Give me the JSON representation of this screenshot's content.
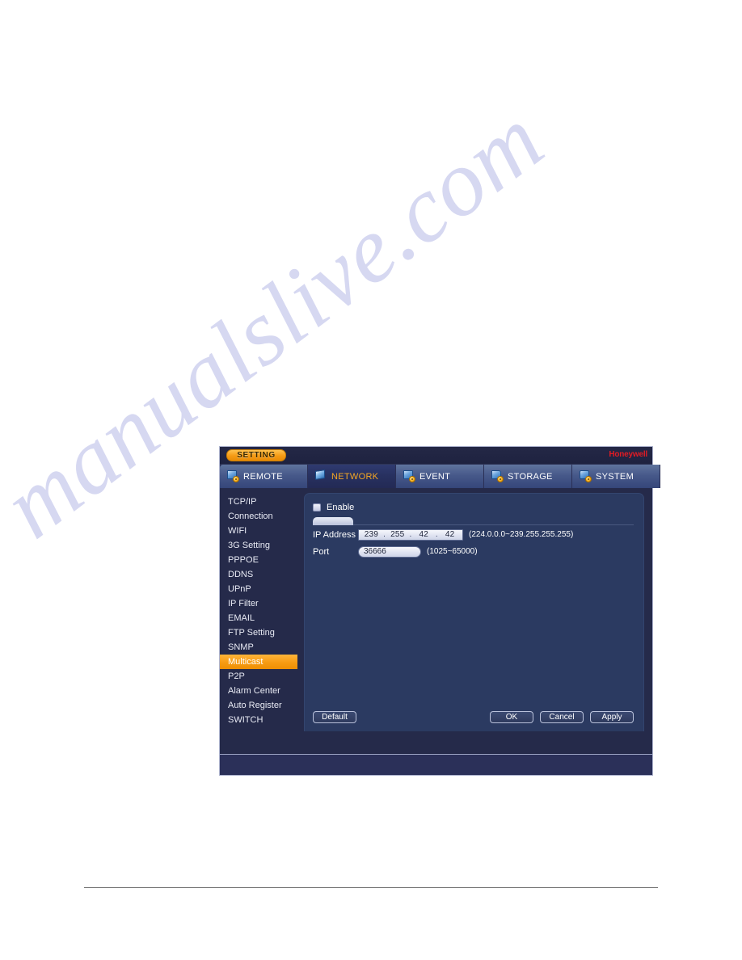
{
  "page": {
    "watermark": "manualslive.com"
  },
  "window": {
    "title_badge": "SETTING",
    "brand": "Honeywell"
  },
  "tabs": [
    {
      "label": "REMOTE",
      "icon": "remote-icon",
      "active": false
    },
    {
      "label": "NETWORK",
      "icon": "network-icon",
      "active": true
    },
    {
      "label": "EVENT",
      "icon": "event-icon",
      "active": false
    },
    {
      "label": "STORAGE",
      "icon": "storage-icon",
      "active": false
    },
    {
      "label": "SYSTEM",
      "icon": "system-icon",
      "active": false
    }
  ],
  "sidebar": {
    "items": [
      {
        "label": "TCP/IP",
        "selected": false
      },
      {
        "label": "Connection",
        "selected": false
      },
      {
        "label": "WIFI",
        "selected": false
      },
      {
        "label": "3G Setting",
        "selected": false
      },
      {
        "label": "PPPOE",
        "selected": false
      },
      {
        "label": "DDNS",
        "selected": false
      },
      {
        "label": "UPnP",
        "selected": false
      },
      {
        "label": "IP Filter",
        "selected": false
      },
      {
        "label": "EMAIL",
        "selected": false
      },
      {
        "label": "FTP Setting",
        "selected": false
      },
      {
        "label": "SNMP",
        "selected": false
      },
      {
        "label": "Multicast",
        "selected": true
      },
      {
        "label": "P2P",
        "selected": false
      },
      {
        "label": "Alarm Center",
        "selected": false
      },
      {
        "label": "Auto Register",
        "selected": false
      },
      {
        "label": "SWITCH",
        "selected": false
      }
    ]
  },
  "form": {
    "enable_label": "Enable",
    "enable_checked": false,
    "ip_label": "IP Address",
    "ip_octets": [
      "239",
      "255",
      "42",
      "42"
    ],
    "ip_hint": "(224.0.0.0~239.255.255.255)",
    "port_label": "Port",
    "port_value": "36666",
    "port_hint": "(1025~65000)"
  },
  "buttons": {
    "default": "Default",
    "ok": "OK",
    "cancel": "Cancel",
    "apply": "Apply"
  },
  "colors": {
    "accent_orange": "#f59a14",
    "brand_red": "#e01b24",
    "panel_blue": "#2b3a61",
    "window_blue": "#252a4a"
  }
}
